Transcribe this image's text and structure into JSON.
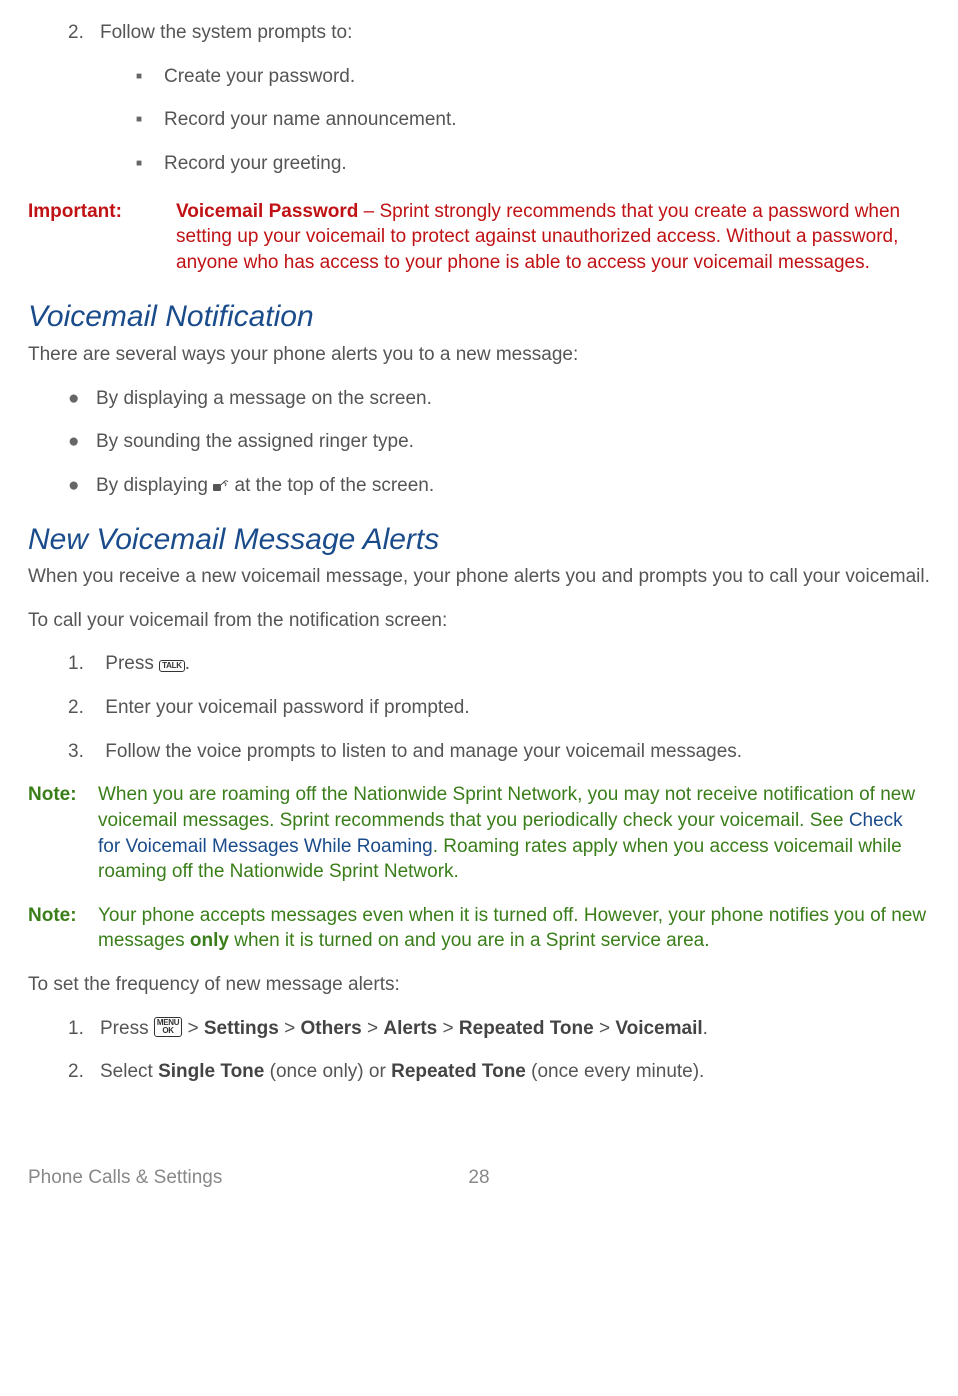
{
  "step2": {
    "num": "2.",
    "text": "Follow the system prompts to:"
  },
  "step2_sub": [
    "Create your password.",
    "Record your name announcement.",
    "Record your greeting."
  ],
  "important": {
    "label": "Important:",
    "bold": "Voicemail Password",
    "rest": " – Sprint strongly recommends that you create a password when setting up your voicemail to protect against unauthorized access. Without a password, anyone who has access to your phone is able to access your voicemail messages."
  },
  "sec1": {
    "title": "Voicemail Notification",
    "intro": "There are several ways your phone alerts you to a new message:",
    "bullets_a": "By displaying a message on the screen.",
    "bullets_b": "By sounding the assigned ringer type.",
    "bullets_c_pre": "By displaying ",
    "bullets_c_post": " at the top of the screen."
  },
  "sec2": {
    "title": "New Voicemail Message Alerts",
    "intro": "When you receive a new voicemail message, your phone alerts you and prompts you to call your voicemail.",
    "lead": "To call your voicemail from the notification screen:",
    "steps": {
      "s1_pre": "Press ",
      "s1_post": ".",
      "s2": "Enter your voicemail password if prompted.",
      "s3": "Follow the voice prompts to listen to and manage your voicemail messages."
    }
  },
  "note1": {
    "label": "Note:",
    "pre": "When you are roaming off the Nationwide Sprint Network, you may not receive notification of new voicemail messages. Sprint recommends that you periodically check your voicemail. See ",
    "link": "Check for Voicemail Messages While Roaming",
    "post": ". Roaming rates apply when you access voicemail while roaming off the Nationwide Sprint Network."
  },
  "note2": {
    "label": "Note:",
    "pre": "Your phone accepts messages even when it is turned off. However, your phone notifies you of new messages ",
    "bold": "only",
    "post": " when it is turned on and you are in a Sprint service area."
  },
  "freq": {
    "lead": "To set the frequency of new message alerts:",
    "s1_num": "1.",
    "s1_pre": "Press ",
    "s1_gt": " > ",
    "s1_settings": "Settings",
    "s1_others": "Others",
    "s1_alerts": "Alerts",
    "s1_repeated": "Repeated Tone",
    "s1_voicemail": "Voicemail",
    "s1_end": ".",
    "s2_num": "2.",
    "s2_pre": "Select ",
    "s2_single": "Single Tone",
    "s2_mid1": " (once only) or ",
    "s2_repeated": "Repeated Tone",
    "s2_mid2": " (once every minute)."
  },
  "key_talk": "TALK",
  "key_menu_top": "MENU",
  "key_menu_bot": "OK",
  "footer": {
    "left": "Phone Calls & Settings",
    "page": "28"
  }
}
